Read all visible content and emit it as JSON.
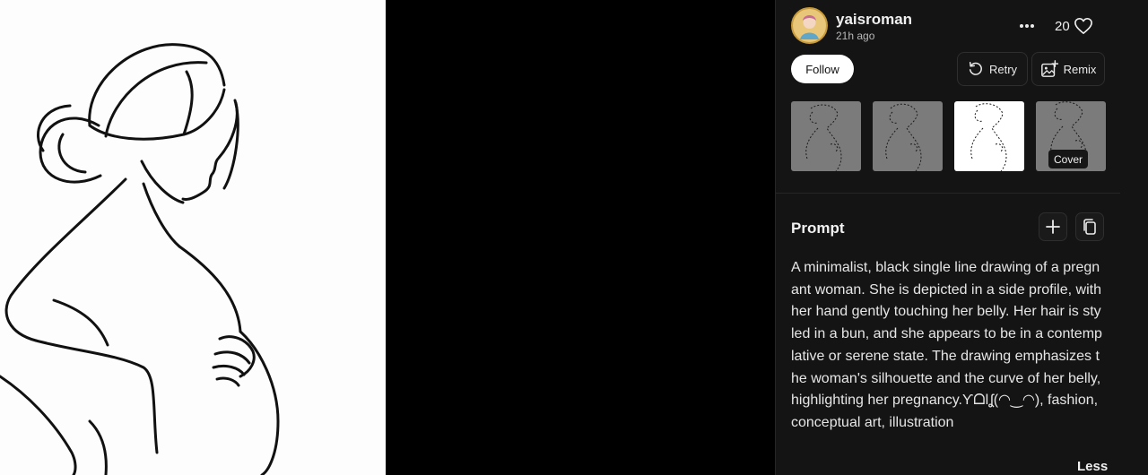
{
  "author": {
    "name": "yaisroman",
    "time": "21h ago",
    "avatar_icon": "avatar-illustration"
  },
  "actions": {
    "more_icon": "ellipsis-icon",
    "like_count": "20",
    "like_icon": "heart-outline-icon",
    "follow_label": "Follow",
    "retry_label": "Retry",
    "retry_icon": "refresh-icon",
    "remix_label": "Remix",
    "remix_icon": "image-plus-icon"
  },
  "thumbnails": {
    "count": 4,
    "selected_index": 2,
    "cover_index": 3,
    "cover_label": "Cover"
  },
  "prompt": {
    "title": "Prompt",
    "add_icon": "plus-icon",
    "copy_icon": "copy-icon",
    "text": "A minimalist, black single line drawing of a pregnant woman. She is depicted in a side profile, with her hand gently touching her belly. Her hair is styled in a bun, and she appears to be in a contemplative or serene state. The drawing emphasizes the woman's silhouette and the curve of her belly, highlighting her pregnancy.ƳᗝƖʆ(◠‿◠), fashion, conceptual art, illustration",
    "toggle_label": "Less"
  },
  "colors": {
    "panel_bg": "#141414",
    "page_bg": "#000000",
    "canvas_bg": "#fdfdfd",
    "accent_text": "#ffffff"
  }
}
